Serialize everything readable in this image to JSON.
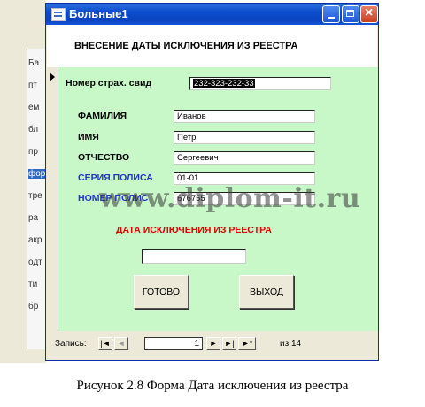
{
  "background": {
    "letters": [
      "Ба",
      "пт",
      "ем",
      "бл",
      "пр",
      "фор",
      "тре",
      "ра",
      "акр",
      "одт",
      "ти",
      "бр"
    ],
    "selected_index": 5
  },
  "window": {
    "title": "Больные1",
    "header_title": "ВНЕСЕНИЕ ДАТЫ ИСКЛЮЧЕНИЯ ИЗ РЕЕСТРА"
  },
  "form": {
    "insurance_label": "Номер страх. свид",
    "insurance_value": "232-323-232-33",
    "surname_label": "ФАМИЛИЯ",
    "surname_value": "Иванов",
    "name_label": "ИМЯ",
    "name_value": "Петр",
    "patronymic_label": "ОТЧЕСТВО",
    "patronymic_value": "Сергеевич",
    "policy_series_label": "СЕРИЯ ПОЛИСА",
    "policy_series_value": "01-01",
    "policy_number_label": "НОМЕР ПОЛИС",
    "policy_number_value": "676755",
    "exclusion_date_label": "ДАТА ИСКЛЮЧЕНИЯ ИЗ РЕЕСТРА",
    "exclusion_date_value": "",
    "done_button": "ГОТОВО",
    "exit_button": "ВЫХОД"
  },
  "navigation": {
    "label": "Запись:",
    "current_record": "1",
    "of_label": "из 14"
  },
  "watermark": "www.diplom-it.ru",
  "caption": "Рисунок 2.8  Форма Дата исключения из реестра",
  "colors": {
    "detail_background": "#c8f7c8",
    "blue_label": "#1f35c8",
    "red_label": "#e00000",
    "titlebar": "#0b4ccc"
  }
}
